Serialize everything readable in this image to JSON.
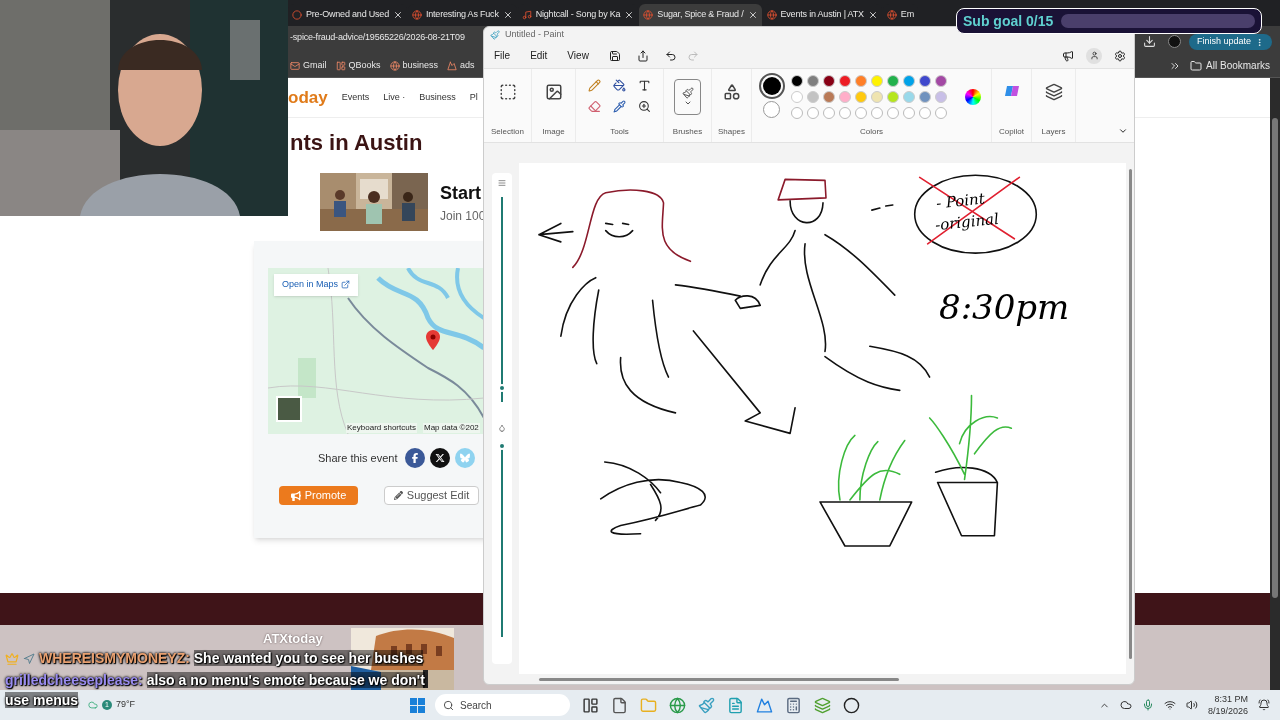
{
  "browser": {
    "tabs": [
      {
        "label": "Pre-Owned and Used",
        "selected": false
      },
      {
        "label": "Interesting As Fuck",
        "selected": false
      },
      {
        "label": "Nightcall - Song by Ka",
        "selected": false
      },
      {
        "label": "Sugar, Spice & Fraud /",
        "selected": true
      },
      {
        "label": "Events in Austin | ATX",
        "selected": false
      },
      {
        "label": "Em",
        "selected": false
      }
    ],
    "address": "-spice-fraud-advice/19565226/2026-08-21T09",
    "update_button": "Finish update",
    "bookmarks": [
      "Gmail",
      "QBooks",
      "business",
      "ads"
    ],
    "all_bookmarks": "All Bookmarks"
  },
  "website": {
    "logo": "oday",
    "nav": [
      "Events",
      "Live ·",
      "Business",
      "Pl"
    ],
    "heading": "nts in Austin",
    "ad": {
      "title": "Start",
      "subtitle": "Join 100"
    },
    "map": {
      "open_link": "Open in Maps",
      "shortcuts": "Keyboard shortcuts",
      "map_data": "Map data ©202"
    },
    "share_label": "Share this event",
    "promote": "Promote",
    "suggest_edit": "Suggest Edit",
    "footer_logo": "ATXtoday"
  },
  "paint": {
    "title": "Untitled - Paint",
    "menu": [
      "File",
      "Edit",
      "View"
    ],
    "groups": [
      "Selection",
      "Image",
      "Tools",
      "Brushes",
      "Shapes",
      "Colors",
      "Copilot",
      "Layers"
    ],
    "primary": {
      "color": "#000000"
    },
    "secondary": {
      "color": "#ffffff"
    },
    "palette": [
      {
        "color": "#000000"
      },
      {
        "color": "#7f7f7f"
      },
      {
        "color": "#880015"
      },
      {
        "color": "#ed1c24"
      },
      {
        "color": "#ff7f27"
      },
      {
        "color": "#fff200"
      },
      {
        "color": "#22b14c"
      },
      {
        "color": "#00a2e8"
      },
      {
        "color": "#3f48cc"
      },
      {
        "color": "#a349a4"
      },
      {
        "color": "#ffffff"
      },
      {
        "color": "#c3c3c3"
      },
      {
        "color": "#b97a57"
      },
      {
        "color": "#ffaec9"
      },
      {
        "color": "#ffc90e"
      },
      {
        "color": "#efe4b0"
      },
      {
        "color": "#b5e61d"
      },
      {
        "color": "#99d9ea"
      },
      {
        "color": "#7092be"
      },
      {
        "color": "#c8bfe7"
      }
    ],
    "sliders": [
      {
        "level": 0.05
      },
      {
        "level": 1
      }
    ],
    "handwriting": [
      "- Point",
      "-original",
      "8:30pm"
    ]
  },
  "stream": {
    "sub_goal": "Sub goal 0/15",
    "chat": [
      {
        "user": "WHEREISMYMONEYZ:",
        "color": "#e8a070",
        "badges": true,
        "text": "She wanted you to see her bushes"
      },
      {
        "user": "grilledcheeseplease:",
        "color": "#9a8cf0",
        "badges": false,
        "text": "also a no menu's emote because we don't use menus"
      }
    ]
  },
  "taskbar": {
    "weather": "79°F",
    "weather_badge": "1",
    "search": "Search",
    "time": "8:31 PM",
    "date": "8/19/2026"
  }
}
